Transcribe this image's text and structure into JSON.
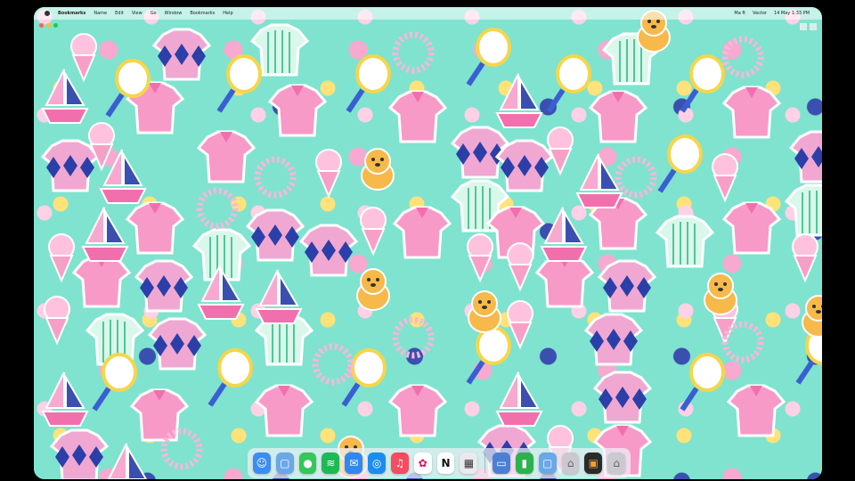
{
  "menubar": {
    "app_name": "Bookmarks",
    "items": [
      "Name",
      "Edit",
      "View",
      "Go",
      "Window",
      "Bookmarks",
      "Help"
    ],
    "status_right": [
      "Ma ft",
      "Vector",
      "14 May 1:33 PM"
    ]
  },
  "dock": {
    "apps": [
      {
        "name": "Finder",
        "icon": "finder-icon",
        "color": "#3b8cf3",
        "glyph": "☺"
      },
      {
        "name": "Folder",
        "icon": "folder-icon",
        "color": "#6aa8e8",
        "glyph": "▢"
      },
      {
        "name": "Messages",
        "icon": "messages-icon",
        "color": "#34c759",
        "glyph": "💬"
      },
      {
        "name": "Spotify",
        "icon": "spotify-icon",
        "color": "#1db954",
        "glyph": "≋"
      },
      {
        "name": "Mail",
        "icon": "mail-icon",
        "color": "#2f88f0",
        "glyph": "✉"
      },
      {
        "name": "Safari",
        "icon": "safari-icon",
        "color": "#1d8cf0",
        "glyph": "◎"
      },
      {
        "name": "Music",
        "icon": "music-icon",
        "color": "#f74b5f",
        "glyph": "♫"
      },
      {
        "name": "Photos",
        "icon": "photos-icon",
        "color": "#ffffff",
        "glyph": "✿"
      },
      {
        "name": "Notion",
        "icon": "notion-icon",
        "color": "#ffffff",
        "glyph": "N"
      },
      {
        "name": "Calendar",
        "icon": "calendar-icon",
        "color": "#e9e9ee",
        "glyph": "▦"
      }
    ],
    "recents": [
      {
        "name": "Preview",
        "icon": "preview-icon",
        "color": "#4a7fd3",
        "glyph": "▭"
      },
      {
        "name": "Numbers",
        "icon": "numbers-icon",
        "color": "#2bb24c",
        "glyph": "▮"
      },
      {
        "name": "Downloads",
        "icon": "downloads-folder-icon",
        "color": "#6aa8e8",
        "glyph": "▢"
      },
      {
        "name": "Trash",
        "icon": "trash-icon",
        "color": "#c9c9cf",
        "glyph": "🗑"
      },
      {
        "name": "Frame",
        "icon": "frame-icon",
        "color": "#2a2a2a",
        "glyph": "▣"
      },
      {
        "name": "Trash2",
        "icon": "trash-full-icon",
        "color": "#c9c9cf",
        "glyph": "🗑"
      }
    ]
  }
}
